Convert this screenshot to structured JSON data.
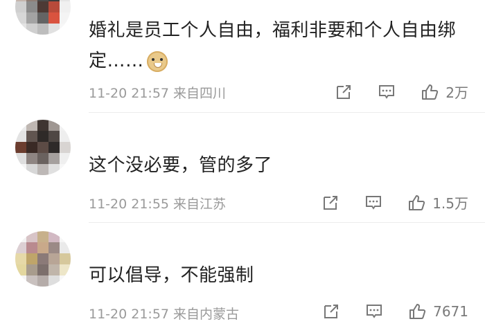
{
  "comments": [
    {
      "text_line1": "婚礼是员工个人自由，福利非要和个人自由绑",
      "text_line2": "定……",
      "emoji": "doge-emoji",
      "meta": "11-20 21:57 来自四川",
      "likes": "2万"
    },
    {
      "text_line1": "这个没必要，管的多了",
      "meta": "11-20 21:55 来自江苏",
      "likes": "1.5万"
    },
    {
      "text_line1": "可以倡导，不能强制",
      "meta": "11-20 21:57 来自内蒙古",
      "likes": "7671"
    }
  ],
  "icons": {
    "forward": "share-forward-icon",
    "comment": "comment-bubble-icon",
    "like": "thumbs-up-icon"
  },
  "colors": {
    "text": "#222222",
    "meta": "#9a9a9a",
    "icon": "#7a7a7a",
    "divider": "#ececec"
  }
}
